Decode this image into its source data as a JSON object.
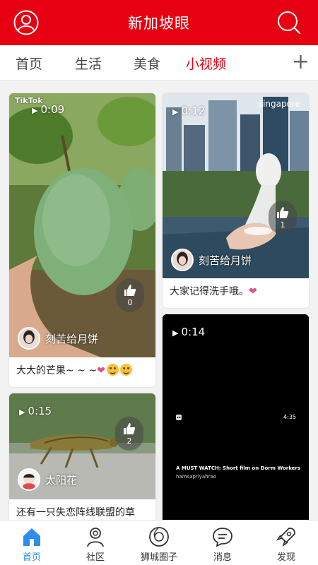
{
  "header": {
    "title": "新加坡眼",
    "user_icon": "user-circle-icon",
    "search_icon": "search-icon"
  },
  "tabs": [
    {
      "label": "首页",
      "active": false
    },
    {
      "label": "生活",
      "active": false
    },
    {
      "label": "美食",
      "active": false
    },
    {
      "label": "小视频",
      "active": true
    }
  ],
  "tab_add": "+",
  "colors": {
    "brand": "#e60012",
    "active_nav": "#2e8ef0",
    "heart": "#e0508a"
  },
  "cards": [
    {
      "duration": "0:09",
      "likes": "0",
      "author": "刻苦给月饼",
      "caption": "大大的芒果~ ~ ~",
      "watermark": "TikTok"
    },
    {
      "duration": "0:12",
      "likes": "1",
      "author": "刻苦给月饼",
      "caption": "大家记得洗手哦。",
      "watermark": "singapore"
    },
    {
      "duration": "0:15",
      "likes": "2",
      "author": "太阳花",
      "caption": "还有一只失恋阵线联盟的草"
    },
    {
      "duration": "0:14",
      "time_right": "4:35",
      "overlay_title": "A MUST WATCH: Short film on Dorm Workers",
      "overlay_sub": "hamsapriyahrao"
    }
  ],
  "bottom_nav": [
    {
      "label": "首页",
      "icon": "home-icon",
      "active": true
    },
    {
      "label": "社区",
      "icon": "community-icon",
      "active": false
    },
    {
      "label": "狮城圈子",
      "icon": "lion-circle-icon",
      "active": false
    },
    {
      "label": "消息",
      "icon": "message-icon",
      "active": false
    },
    {
      "label": "发现",
      "icon": "rocket-icon",
      "active": false
    }
  ]
}
